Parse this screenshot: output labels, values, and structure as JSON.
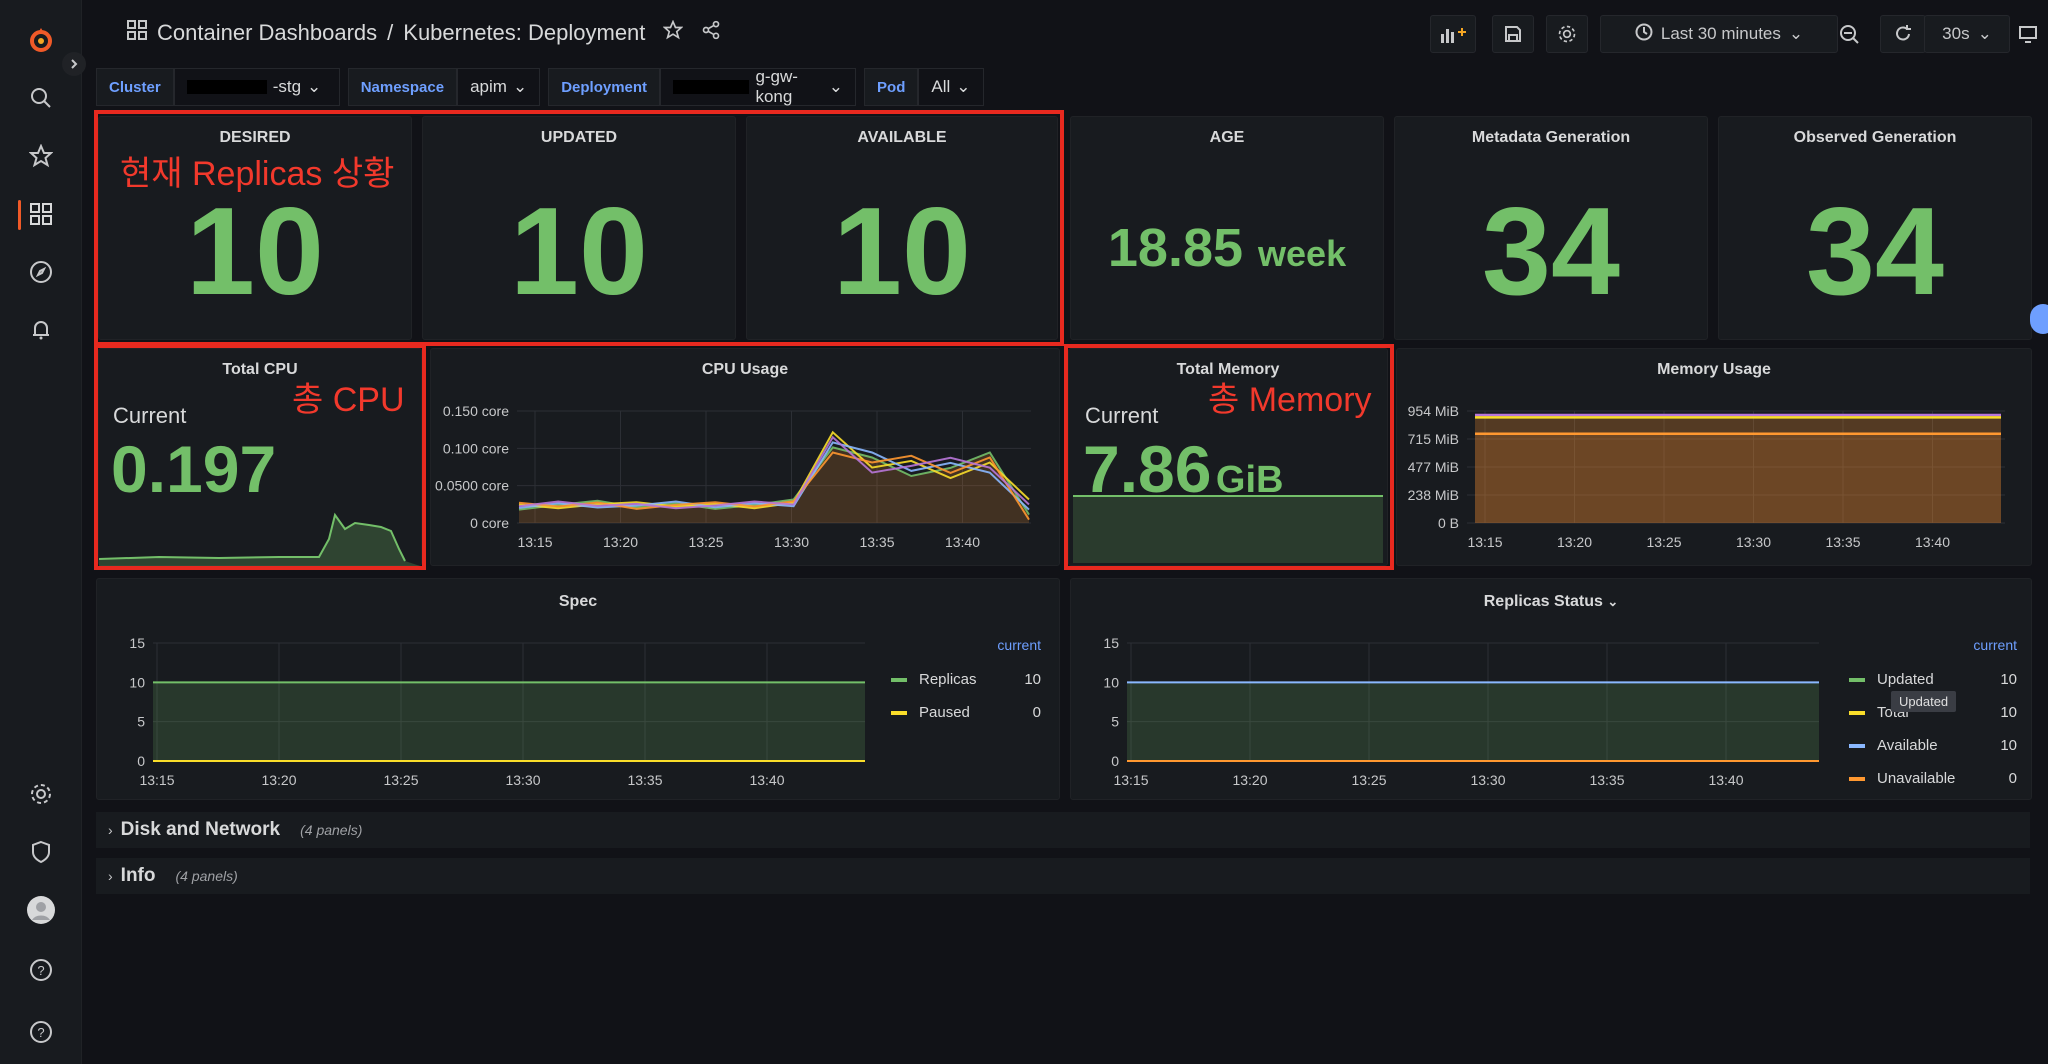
{
  "breadcrumb": {
    "folder": "Container Dashboards",
    "separator": "/",
    "title": "Kubernetes: Deployment"
  },
  "toolbar": {
    "time_range": "Last 30 minutes",
    "refresh_interval": "30s"
  },
  "variables": [
    {
      "label": "Cluster",
      "value": "-stg"
    },
    {
      "label": "Namespace",
      "value": "apim"
    },
    {
      "label": "Deployment",
      "value": "g-gw-kong"
    },
    {
      "label": "Pod",
      "value": "All"
    }
  ],
  "stats": {
    "desired": {
      "title": "DESIRED",
      "value": "10"
    },
    "updated": {
      "title": "UPDATED",
      "value": "10"
    },
    "available": {
      "title": "AVAILABLE",
      "value": "10"
    },
    "age": {
      "title": "AGE",
      "value": "18.85",
      "unit": "week"
    },
    "metadata_generation": {
      "title": "Metadata Generation",
      "value": "34"
    },
    "observed_generation": {
      "title": "Observed Generation",
      "value": "34"
    }
  },
  "total_cpu": {
    "title": "Total CPU",
    "label": "Current",
    "value": "0.197"
  },
  "total_memory": {
    "title": "Total Memory",
    "label": "Current",
    "value": "7.86",
    "unit": "GiB"
  },
  "annotations": {
    "replicas": "현재 Replicas 상황",
    "cpu": "총 CPU",
    "memory": "총 Memory"
  },
  "colors": {
    "green": "#73bf69",
    "yellow": "#fade2a",
    "blue": "#8ab8ff",
    "orange": "#ff9830",
    "purple": "#b877d9",
    "red_annot": "#e8291f",
    "accent": "#6e9fff"
  },
  "time_ticks": [
    "13:15",
    "13:20",
    "13:25",
    "13:30",
    "13:35",
    "13:40"
  ],
  "cpu_usage": {
    "title": "CPU Usage",
    "y_ticks": [
      "0.150 core",
      "0.100 core",
      "0.0500 core",
      "0 core"
    ]
  },
  "memory_usage": {
    "title": "Memory Usage",
    "y_ticks": [
      "954 MiB",
      "715 MiB",
      "477 MiB",
      "238 MiB",
      "0 B"
    ]
  },
  "spec": {
    "title": "Spec",
    "y_ticks": [
      "15",
      "10",
      "5",
      "0"
    ],
    "legend_header": "current",
    "legend": [
      {
        "name": "Replicas",
        "value": "10",
        "color": "#73bf69"
      },
      {
        "name": "Paused",
        "value": "0",
        "color": "#fade2a"
      }
    ]
  },
  "replicas_status": {
    "title": "Replicas Status",
    "y_ticks": [
      "15",
      "10",
      "5",
      "0"
    ],
    "legend_header": "current",
    "legend": [
      {
        "name": "Updated",
        "value": "10",
        "color": "#73bf69"
      },
      {
        "name": "Total",
        "value": "10",
        "color": "#fade2a"
      },
      {
        "name": "Available",
        "value": "10",
        "color": "#8ab8ff"
      },
      {
        "name": "Unavailable",
        "value": "0",
        "color": "#ff9830"
      }
    ],
    "tooltip": "Updated"
  },
  "rows": [
    {
      "title": "Disk and Network",
      "count": "(4 panels)"
    },
    {
      "title": "Info",
      "count": "(4 panels)"
    }
  ],
  "chart_data": [
    {
      "type": "line",
      "title": "CPU Usage",
      "x": [
        "13:13",
        "13:16",
        "13:19",
        "13:22",
        "13:25",
        "13:28",
        "13:31",
        "13:34",
        "13:35",
        "13:36",
        "13:38",
        "13:40",
        "13:42",
        "13:43"
      ],
      "series": [
        {
          "values": [
            0.025,
            0.027,
            0.028,
            0.026,
            0.027,
            0.026,
            0.027,
            0.03,
            0.12,
            0.09,
            0.085,
            0.082,
            0.09,
            0.02
          ]
        }
      ],
      "ylim": [
        0,
        0.16
      ]
    },
    {
      "type": "area",
      "title": "Memory Usage",
      "series": [
        {
          "values": [
            920,
            920,
            920,
            920,
            920,
            920
          ]
        },
        {
          "values": [
            900,
            900,
            900,
            900,
            900,
            900
          ]
        },
        {
          "values": [
            760,
            760,
            760,
            760,
            760,
            760
          ]
        }
      ],
      "ylim": [
        0,
        1000
      ]
    }
  ]
}
